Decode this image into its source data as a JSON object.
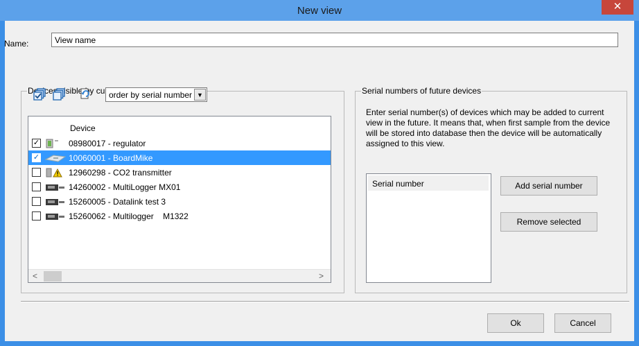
{
  "window": {
    "title": "New view",
    "close_symbol": "✕"
  },
  "name_field": {
    "label": "Name:",
    "value": "View name"
  },
  "devices_group": {
    "legend": "Devices visible by current view",
    "toolbar": {
      "check_all_icon": "check-all-icon",
      "uncheck_all_icon": "uncheck-all-icon",
      "refresh_icon": "refresh-icon"
    },
    "order_select": {
      "value": "order by serial number",
      "arrow": "▼"
    },
    "column_header": "Device",
    "rows": [
      {
        "text": "08980017 - regulator",
        "checked": true,
        "selected": false,
        "icon": "regulator-icon"
      },
      {
        "text": "10060001 - BoardMike",
        "checked": true,
        "selected": true,
        "icon": "board-icon"
      },
      {
        "text": "12960298 - CO2 transmitter",
        "checked": false,
        "selected": false,
        "icon": "warning-device-icon"
      },
      {
        "text": "14260002 - MultiLogger MX01",
        "checked": false,
        "selected": false,
        "icon": "logger-icon"
      },
      {
        "text": "15260005 - Datalink test 3",
        "checked": false,
        "selected": false,
        "icon": "logger-icon"
      },
      {
        "text": "15260062 - Multilogger    M1322",
        "checked": false,
        "selected": false,
        "icon": "logger-icon"
      }
    ],
    "scroll_left": "<",
    "scroll_right": ">"
  },
  "serials_group": {
    "legend": "Serial numbers of future devices",
    "description": "Enter serial number(s) of devices which may be added to current view in the future. It means that, when first sample from the device will be stored into database then the device will be automatically assigned to this view.",
    "list_header": "Serial number",
    "add_button": "Add serial number",
    "remove_button": "Remove selected"
  },
  "footer": {
    "ok": "Ok",
    "cancel": "Cancel"
  }
}
